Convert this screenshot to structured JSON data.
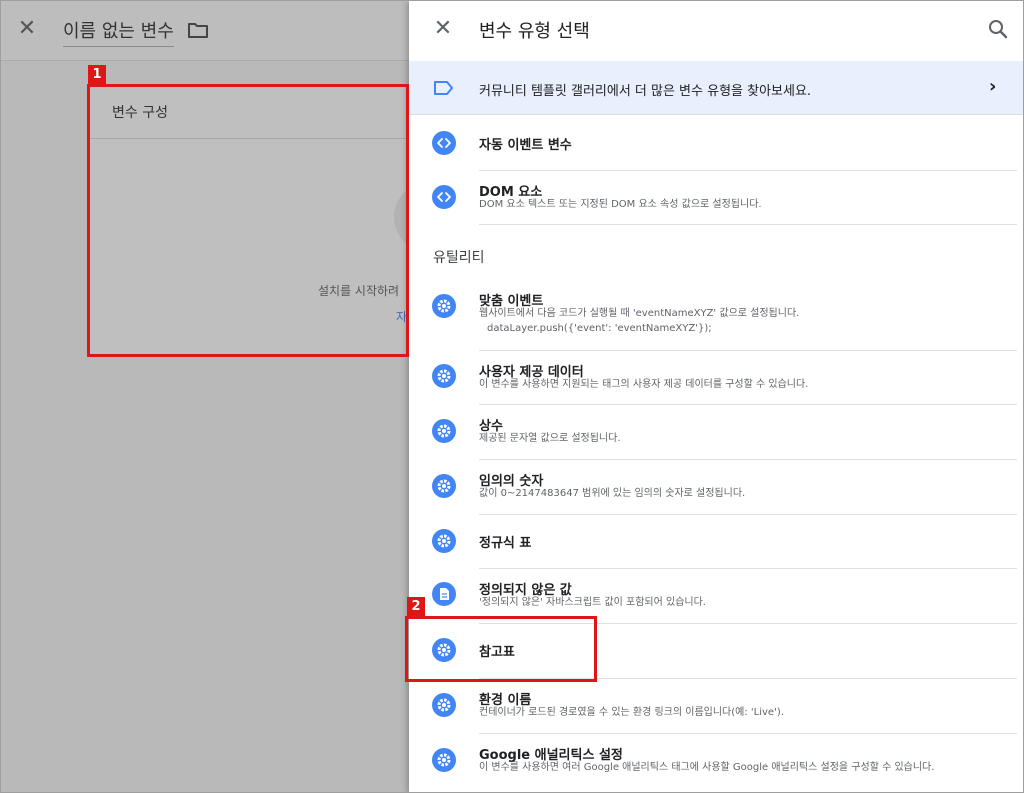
{
  "left": {
    "title": "이름 없는 변수",
    "config_title": "변수 구성",
    "config_hint": "설치를 시작하려",
    "config_link": "자"
  },
  "panel": {
    "title": "변수 유형 선택",
    "gallery_text": "커뮤니티 템플릿 갤러리에서 더 많은 변수 유형을 찾아보세요.",
    "section_utility": "유틸리티",
    "items": [
      {
        "name": "자동 이벤트 변수",
        "desc": "",
        "desc2": "",
        "icon": "code-icon"
      },
      {
        "name": "DOM 요소",
        "desc": "DOM 요소 텍스트 또는 지정된 DOM 요소 속성 값으로 설정됩니다.",
        "desc2": "",
        "icon": "code-icon"
      },
      {
        "name": "맞춤 이벤트",
        "desc": "웹사이트에서 다음 코드가 실행될 때 'eventNameXYZ' 값으로 설정됩니다.",
        "desc2": "dataLayer.push({'event': 'eventNameXYZ'});",
        "icon": "gear-icon"
      },
      {
        "name": "사용자 제공 데이터",
        "desc": "이 변수를 사용하면 지원되는 태그의 사용자 제공 데이터를 구성할 수 있습니다.",
        "desc2": "",
        "icon": "gear-icon"
      },
      {
        "name": "상수",
        "desc": "제공된 문자열 값으로 설정됩니다.",
        "desc2": "",
        "icon": "gear-icon"
      },
      {
        "name": "임의의 숫자",
        "desc": "값이 0~2147483647 범위에 있는 임의의 숫자로 설정됩니다.",
        "desc2": "",
        "icon": "gear-icon"
      },
      {
        "name": "정규식 표",
        "desc": "",
        "desc2": "",
        "icon": "gear-icon"
      },
      {
        "name": "정의되지 않은 값",
        "desc": "'정의되지 않은' 자바스크립트 값이 포함되어 있습니다.",
        "desc2": "",
        "icon": "document-icon"
      },
      {
        "name": "참고표",
        "desc": "",
        "desc2": "",
        "icon": "gear-icon"
      },
      {
        "name": "환경 이름",
        "desc": "컨테이너가 로드된 경로였을 수 있는 환경 링크의 이름입니다(예: 'Live').",
        "desc2": "",
        "icon": "gear-icon"
      },
      {
        "name": "Google 애널리틱스 설정",
        "desc": "이 변수를 사용하면 여러 Google 애널리틱스 태그에 사용할 Google 애널리틱스 설정을 구성할 수 있습니다.",
        "desc2": "",
        "icon": "gear-icon"
      }
    ]
  },
  "annotations": {
    "badge1": "1",
    "badge2": "2"
  },
  "colors": {
    "accent": "#4285f4",
    "highlight": "#e01515",
    "gallery_bg": "#e8f0fe"
  }
}
